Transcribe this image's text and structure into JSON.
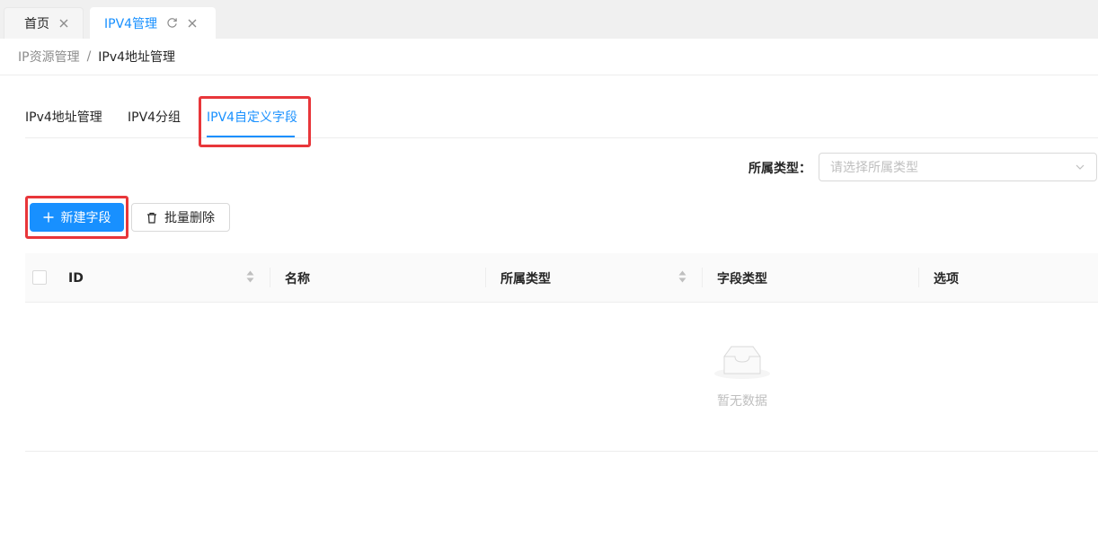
{
  "page_tabs": [
    {
      "label": "首页",
      "active": false
    },
    {
      "label": "IPV4管理",
      "active": true
    }
  ],
  "breadcrumb": {
    "parent": "IP资源管理",
    "separator": "/",
    "current": "IPv4地址管理"
  },
  "subtabs": [
    {
      "label": "IPv4地址管理",
      "active": false
    },
    {
      "label": "IPV4分组",
      "active": false
    },
    {
      "label": "IPV4自定义字段",
      "active": true
    }
  ],
  "filter": {
    "label": "所属类型：",
    "placeholder": "请选择所属类型"
  },
  "toolbar": {
    "new_label": "新建字段",
    "batch_delete_label": "批量删除"
  },
  "table": {
    "columns": [
      "ID",
      "名称",
      "所属类型",
      "字段类型",
      "选项"
    ],
    "empty_text": "暂无数据"
  },
  "colors": {
    "primary": "#1890ff",
    "highlight": "#e8363a"
  }
}
